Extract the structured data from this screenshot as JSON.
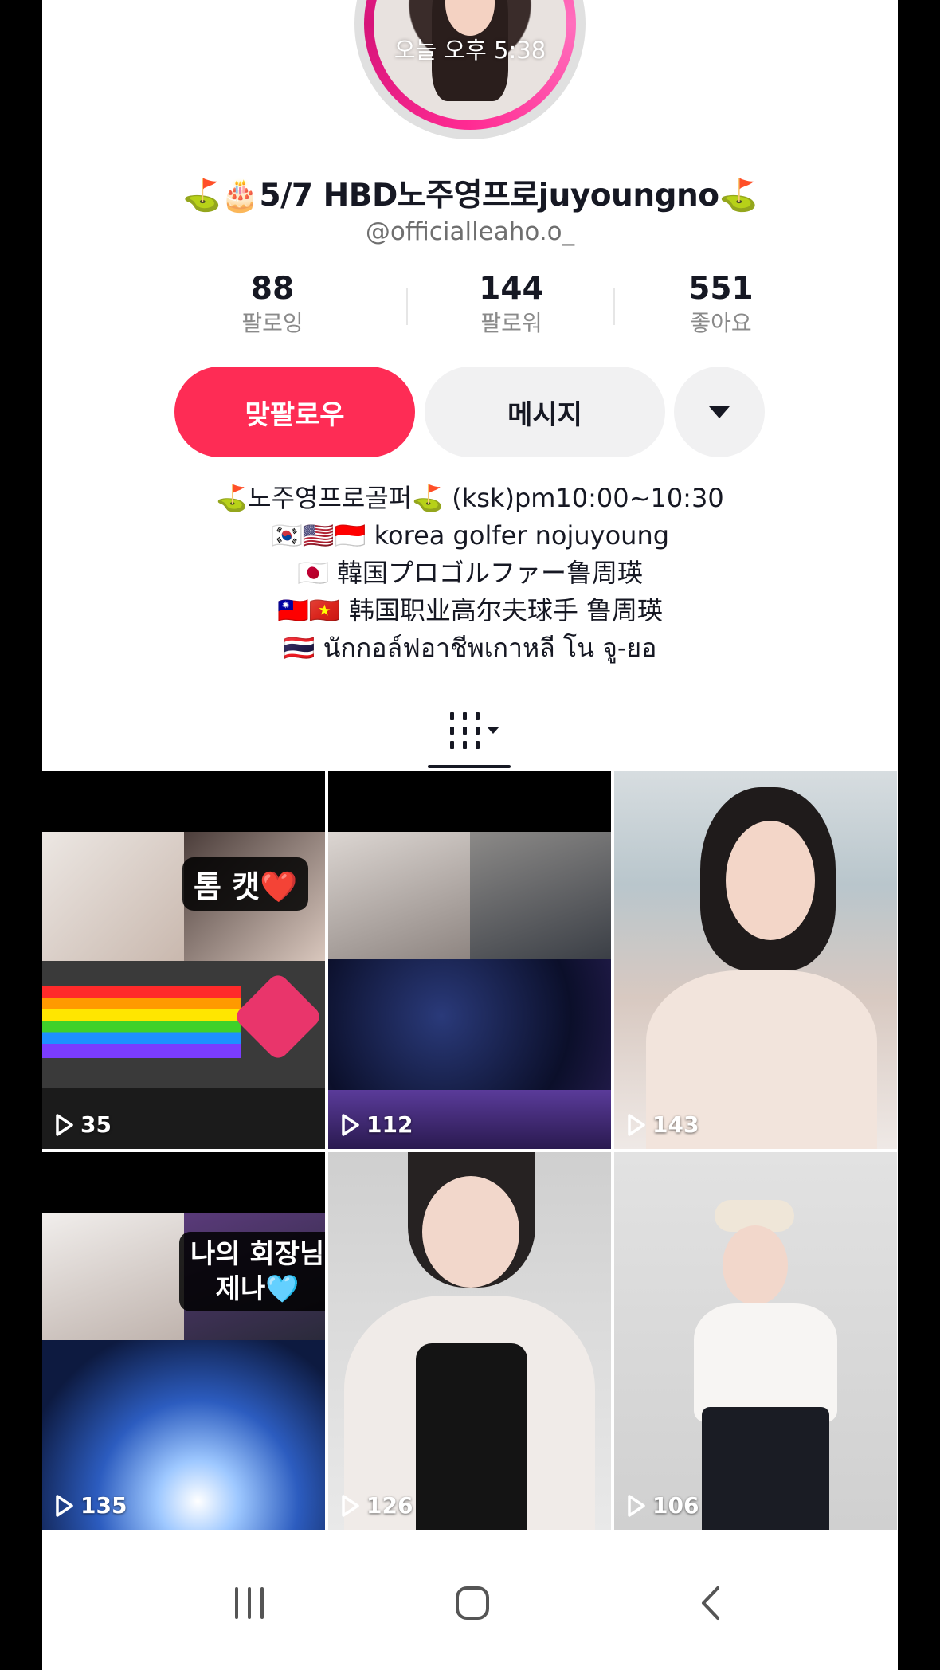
{
  "header": {
    "live_time": "오늘 오후 5:38",
    "display_name": "⛳🎂5/7 HBD노주영프로juyoungno⛳",
    "handle": "@officialleaho.o_"
  },
  "stats": [
    {
      "value": "88",
      "label": "팔로잉"
    },
    {
      "value": "144",
      "label": "팔로워"
    },
    {
      "value": "551",
      "label": "좋아요"
    }
  ],
  "actions": {
    "follow_label": "맞팔로우",
    "message_label": "메시지"
  },
  "bio": [
    "⛳노주영프로골퍼⛳ (ksk)pm10:00~10:30",
    "🇰🇷🇺🇸🇮🇩 korea golfer nojuyoung",
    "🇯🇵 韓国プロゴルファー鲁周瑛",
    "🇹🇼🇻🇳 韩国职业高尔夫球手 鲁周瑛",
    "🇹🇭 นักกอล์ฟอาชีพเกาหลี โน จู-ยอ"
  ],
  "videos": [
    {
      "views": "35",
      "overlay": "톰 캣❤️"
    },
    {
      "views": "112",
      "overlay": ""
    },
    {
      "views": "143",
      "overlay": ""
    },
    {
      "views": "135",
      "overlay": "나의 회장님\n제나🩵"
    },
    {
      "views": "126",
      "overlay": ""
    },
    {
      "views": "106",
      "overlay": ""
    }
  ],
  "icons": {
    "back": "chevron-left-icon",
    "share": "share-arrow-icon",
    "flag": "report-flag-icon",
    "grid": "video-grid-icon",
    "play": "play-icon"
  },
  "colors": {
    "accent": "#fe2c55",
    "avatar_ring": "#ff2b93"
  }
}
